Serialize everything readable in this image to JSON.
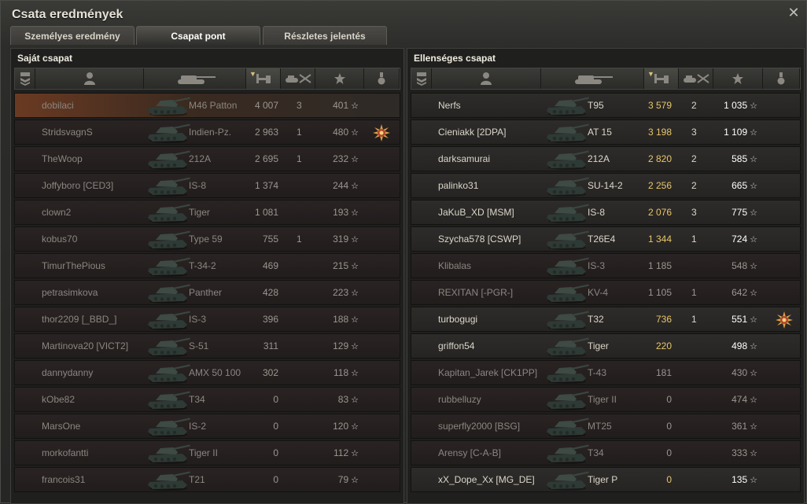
{
  "window": {
    "title": "Csata eredmények"
  },
  "tabs": [
    {
      "label": "Személyes eredmény"
    },
    {
      "label": "Csapat pont"
    },
    {
      "label": "Részletes jelentés"
    }
  ],
  "columns": {
    "rank": "rank-icon",
    "player": "player-icon",
    "tank": "tank-icon",
    "damage": "damage-icon",
    "kills": "kills-icon",
    "xp": "xp-star-icon",
    "medal": "medal-icon"
  },
  "teams": [
    {
      "title": "Saját csapat",
      "rows": [
        {
          "name": "dobilaci",
          "tank": "M46 Patton",
          "damage": "4 007",
          "kills": "3",
          "xp": "401",
          "medal": false,
          "dead": true
        },
        {
          "name": "StridsvagnS",
          "tank": "Indien-Pz.",
          "damage": "2 963",
          "kills": "1",
          "xp": "480",
          "medal": true,
          "dead": true
        },
        {
          "name": "TheWoop",
          "tank": "212A",
          "damage": "2 695",
          "kills": "1",
          "xp": "232",
          "medal": false,
          "dead": true
        },
        {
          "name": "Joffyboro [CED3]",
          "tank": "IS-8",
          "damage": "1 374",
          "kills": "",
          "xp": "244",
          "medal": false,
          "dead": true
        },
        {
          "name": "clown2",
          "tank": "Tiger",
          "damage": "1 081",
          "kills": "",
          "xp": "193",
          "medal": false,
          "dead": true
        },
        {
          "name": "kobus70",
          "tank": "Type 59",
          "damage": "755",
          "kills": "1",
          "xp": "319",
          "medal": false,
          "dead": true
        },
        {
          "name": "TimurThePious",
          "tank": "T-34-2",
          "damage": "469",
          "kills": "",
          "xp": "215",
          "medal": false,
          "dead": true
        },
        {
          "name": "petrasimkova",
          "tank": "Panther",
          "damage": "428",
          "kills": "",
          "xp": "223",
          "medal": false,
          "dead": true
        },
        {
          "name": "thor2209 [_BBD_]",
          "tank": "IS-3",
          "damage": "396",
          "kills": "",
          "xp": "188",
          "medal": false,
          "dead": true
        },
        {
          "name": "Martinova20 [VICT2]",
          "tank": "S-51",
          "damage": "311",
          "kills": "",
          "xp": "129",
          "medal": false,
          "dead": true
        },
        {
          "name": "dannydanny",
          "tank": "AMX 50 100",
          "damage": "302",
          "kills": "",
          "xp": "118",
          "medal": false,
          "dead": true
        },
        {
          "name": "kObe82",
          "tank": "T34",
          "damage": "0",
          "kills": "",
          "xp": "83",
          "medal": false,
          "dead": true
        },
        {
          "name": "MarsOne",
          "tank": "IS-2",
          "damage": "0",
          "kills": "",
          "xp": "120",
          "medal": false,
          "dead": true
        },
        {
          "name": "morkofantti",
          "tank": "Tiger II",
          "damage": "0",
          "kills": "",
          "xp": "112",
          "medal": false,
          "dead": true
        },
        {
          "name": "francois31",
          "tank": "T21",
          "damage": "0",
          "kills": "",
          "xp": "79",
          "medal": false,
          "dead": true
        }
      ]
    },
    {
      "title": "Ellenséges csapat",
      "rows": [
        {
          "name": "Nerfs",
          "tank": "T95",
          "damage": "3 579",
          "kills": "2",
          "xp": "1 035",
          "medal": false,
          "dead": false
        },
        {
          "name": "Cieniakk [2DPA]",
          "tank": "AT 15",
          "damage": "3 198",
          "kills": "3",
          "xp": "1 109",
          "medal": false,
          "dead": false
        },
        {
          "name": "darksamurai",
          "tank": "212A",
          "damage": "2 820",
          "kills": "2",
          "xp": "585",
          "medal": false,
          "dead": false
        },
        {
          "name": "palinko31",
          "tank": "SU-14-2",
          "damage": "2 256",
          "kills": "2",
          "xp": "665",
          "medal": false,
          "dead": false
        },
        {
          "name": "JaKuB_XD [MSM]",
          "tank": "IS-8",
          "damage": "2 076",
          "kills": "3",
          "xp": "775",
          "medal": false,
          "dead": false
        },
        {
          "name": "Szycha578 [CSWP]",
          "tank": "T26E4",
          "damage": "1 344",
          "kills": "1",
          "xp": "724",
          "medal": false,
          "dead": false
        },
        {
          "name": "Klibalas",
          "tank": "IS-3",
          "damage": "1 185",
          "kills": "",
          "xp": "548",
          "medal": false,
          "dead": true
        },
        {
          "name": "REXITAN [-PGR-]",
          "tank": "KV-4",
          "damage": "1 105",
          "kills": "1",
          "xp": "642",
          "medal": false,
          "dead": true
        },
        {
          "name": "turbogugi",
          "tank": "T32",
          "damage": "736",
          "kills": "1",
          "xp": "551",
          "medal": true,
          "dead": false
        },
        {
          "name": "griffon54",
          "tank": "Tiger",
          "damage": "220",
          "kills": "",
          "xp": "498",
          "medal": false,
          "dead": false
        },
        {
          "name": "Kapitan_Jarek [CK1PP]",
          "tank": "T-43",
          "damage": "181",
          "kills": "",
          "xp": "430",
          "medal": false,
          "dead": true
        },
        {
          "name": "rubbelluzy",
          "tank": "Tiger II",
          "damage": "0",
          "kills": "",
          "xp": "474",
          "medal": false,
          "dead": true
        },
        {
          "name": "superfly2000 [BSG]",
          "tank": "MT25",
          "damage": "0",
          "kills": "",
          "xp": "361",
          "medal": false,
          "dead": true
        },
        {
          "name": "Arensy [C-A-B]",
          "tank": "T34",
          "damage": "0",
          "kills": "",
          "xp": "333",
          "medal": false,
          "dead": true
        },
        {
          "name": "xX_Dope_Xx [MG_DE]",
          "tank": "Tiger P",
          "damage": "0",
          "kills": "",
          "xp": "135",
          "medal": false,
          "dead": false
        }
      ]
    }
  ]
}
